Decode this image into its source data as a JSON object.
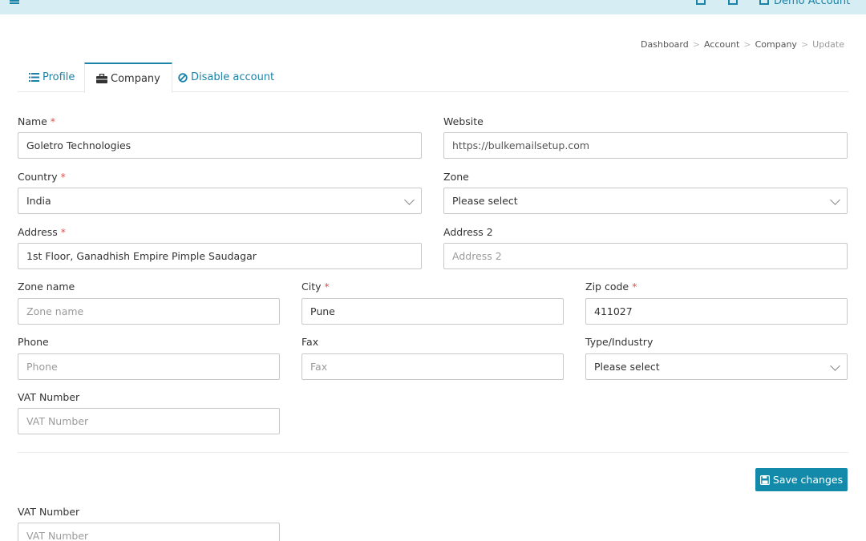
{
  "topbar": {
    "user_label": "Demo Account"
  },
  "breadcrumb": [
    "Dashboard",
    "Account",
    "Company",
    "Update"
  ],
  "tabs": [
    {
      "label": "Profile",
      "icon": "list-icon"
    },
    {
      "label": "Company",
      "icon": "briefcase-icon"
    },
    {
      "label": "Disable account",
      "icon": "ban-icon"
    }
  ],
  "form": {
    "name": {
      "label": "Name",
      "value": "Goletro Technologies"
    },
    "website": {
      "label": "Website",
      "value": "https://bulkemailsetup.com"
    },
    "country": {
      "label": "Country",
      "value": "India"
    },
    "zone": {
      "label": "Zone",
      "value": "Please select"
    },
    "address": {
      "label": "Address",
      "value": "1st Floor, Ganadhish Empire Pimple Saudagar"
    },
    "address2": {
      "label": "Address 2",
      "placeholder": "Address 2"
    },
    "zone_name": {
      "label": "Zone name",
      "placeholder": "Zone name"
    },
    "city": {
      "label": "City",
      "value": "Pune"
    },
    "zip": {
      "label": "Zip code",
      "value": "411027"
    },
    "phone": {
      "label": "Phone",
      "placeholder": "Phone"
    },
    "fax": {
      "label": "Fax",
      "placeholder": "Fax"
    },
    "industry": {
      "label": "Type/Industry",
      "value": "Please select"
    },
    "vat": {
      "label": "VAT Number",
      "placeholder": "VAT Number"
    },
    "vat2": {
      "label": "VAT Number",
      "placeholder": "VAT Number"
    },
    "required_mark": "*"
  },
  "actions": {
    "save_label": "Save changes"
  },
  "colors": {
    "accent": "#138aaa",
    "link": "#1b82a8",
    "required": "#d9534f",
    "topbar": "#d6eef3"
  }
}
